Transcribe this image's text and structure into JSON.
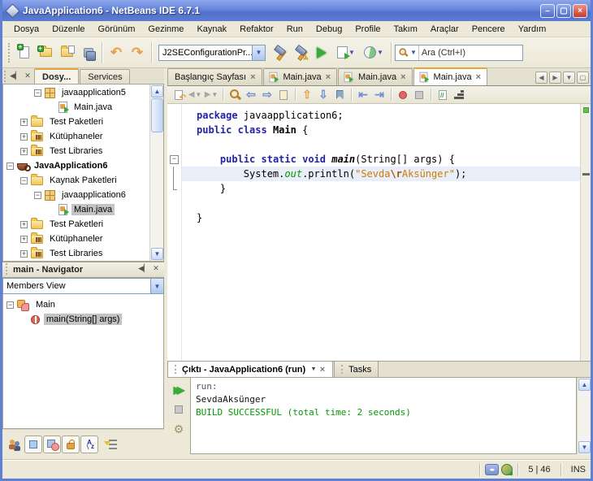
{
  "window": {
    "title": "JavaApplication6 - NetBeans IDE 6.7.1"
  },
  "menubar": [
    "Dosya",
    "Düzenle",
    "Görünüm",
    "Gezinme",
    "Kaynak",
    "Refaktor",
    "Run",
    "Debug",
    "Profile",
    "Takım",
    "Araçlar",
    "Pencere",
    "Yardım"
  ],
  "toolbar": {
    "config_value": "J2SEConfigurationPr...",
    "search_value": "Ara (Ctrl+I)"
  },
  "projects": {
    "tabs": [
      {
        "label": "Dosy..."
      },
      {
        "label": "Services"
      }
    ],
    "tree": [
      {
        "level": 2,
        "expander": "minus",
        "icon": "package-icon",
        "label": "javaapplication5"
      },
      {
        "level": 3,
        "expander": "none",
        "icon": "java-file-icon",
        "label": "Main.java"
      },
      {
        "level": 1,
        "expander": "plus",
        "icon": "folder-icon",
        "label": "Test Paketleri"
      },
      {
        "level": 1,
        "expander": "plus",
        "icon": "library-folder-icon",
        "label": "Kütüphaneler"
      },
      {
        "level": 1,
        "expander": "plus",
        "icon": "library-folder-icon",
        "label": "Test Libraries"
      },
      {
        "level": 0,
        "expander": "minus",
        "icon": "project-icon",
        "label": "JavaApplication6",
        "bold": true
      },
      {
        "level": 1,
        "expander": "minus",
        "icon": "source-folder-icon",
        "label": "Kaynak Paketleri"
      },
      {
        "level": 2,
        "expander": "minus",
        "icon": "package-icon",
        "label": "javaapplication6"
      },
      {
        "level": 3,
        "expander": "none",
        "icon": "java-file-icon",
        "label": "Main.java",
        "selected": true
      },
      {
        "level": 1,
        "expander": "plus",
        "icon": "folder-icon",
        "label": "Test Paketleri"
      },
      {
        "level": 1,
        "expander": "plus",
        "icon": "library-folder-icon",
        "label": "Kütüphaneler"
      },
      {
        "level": 1,
        "expander": "plus",
        "icon": "library-folder-icon",
        "label": "Test Libraries"
      }
    ]
  },
  "navigator": {
    "title": "main - Navigator",
    "view_selector": "Members View",
    "tree": [
      {
        "level": 0,
        "expander": "minus",
        "icon": "class-icon",
        "label": "Main"
      },
      {
        "level": 1,
        "expander": "none",
        "icon": "method-icon",
        "label": "main(String[] args)",
        "selected": true
      }
    ]
  },
  "editor": {
    "tabs": [
      {
        "label": "Başlangıç Sayfası",
        "icon": false,
        "active": false
      },
      {
        "label": "Main.java",
        "icon": true,
        "active": false
      },
      {
        "label": "Main.java",
        "icon": true,
        "active": false
      },
      {
        "label": "Main.java",
        "icon": true,
        "active": true
      }
    ],
    "code": [
      {
        "tokens": [
          [
            "package",
            "kw"
          ],
          [
            " javaapplication6;",
            "pl"
          ]
        ]
      },
      {
        "tokens": [
          [
            "public",
            "kw"
          ],
          [
            " ",
            "pl"
          ],
          [
            "class",
            "kw"
          ],
          [
            " ",
            "pl"
          ],
          [
            "Main",
            "cls"
          ],
          [
            " {",
            "pl"
          ]
        ]
      },
      {
        "tokens": []
      },
      {
        "fold": "start",
        "tokens": [
          [
            "    ",
            "pl"
          ],
          [
            "public",
            "kw"
          ],
          [
            " ",
            "pl"
          ],
          [
            "static",
            "kw"
          ],
          [
            " ",
            "pl"
          ],
          [
            "void",
            "kw"
          ],
          [
            " ",
            "pl"
          ],
          [
            "main",
            "mtd"
          ],
          [
            "(String[] args) {",
            "pl"
          ]
        ]
      },
      {
        "fold": "mid",
        "highlight": true,
        "tokens": [
          [
            "        System.",
            "pl"
          ],
          [
            "out",
            "fld"
          ],
          [
            ".println(",
            "pl"
          ],
          [
            "\"Sevda",
            "str"
          ],
          [
            "\\r",
            "esc"
          ],
          [
            "Aksünger\"",
            "str"
          ],
          [
            ");",
            "pl"
          ]
        ]
      },
      {
        "fold": "end",
        "tokens": [
          [
            "    }",
            "pl"
          ]
        ]
      },
      {
        "tokens": []
      },
      {
        "tokens": [
          [
            "}",
            "pl"
          ]
        ]
      }
    ]
  },
  "output": {
    "tabs": [
      {
        "label": "Çıktı - JavaApplication6 (run)",
        "active": true
      },
      {
        "label": "Tasks",
        "active": false
      }
    ],
    "lines": [
      {
        "text": "run:",
        "style": "plain"
      },
      {
        "text": "SevdaAksünger",
        "style": "stdout"
      },
      {
        "text": "BUILD SUCCESSFUL (total time: 2 seconds)",
        "style": "success"
      }
    ]
  },
  "statusbar": {
    "caret_position": "5 | 46",
    "insert_mode": "INS"
  },
  "colors": {
    "keyword": "#2323A8",
    "string": "#CE7B00",
    "field_green": "#009900",
    "build_success": "#009A00",
    "selection_gray": "#C4C4C4",
    "current_line": "#E9EFF8",
    "titlebar_blue": "#5E7CD2",
    "panel_beige": "#ECE9D8"
  }
}
